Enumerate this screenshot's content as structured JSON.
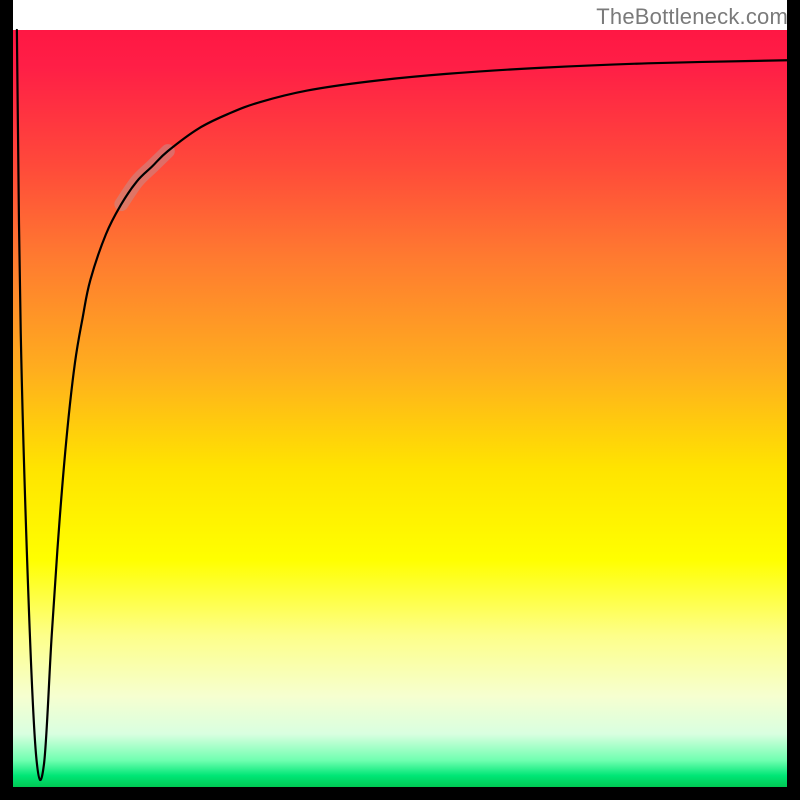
{
  "watermark": "TheBottleneck.com",
  "chart_data": {
    "type": "line",
    "title": "",
    "xlabel": "",
    "ylabel": "",
    "xlim": [
      0,
      100
    ],
    "ylim": [
      0,
      100
    ],
    "grid": false,
    "background_gradient": {
      "stops": [
        {
          "offset": 0.0,
          "color": "#ff1744"
        },
        {
          "offset": 0.05,
          "color": "#ff1f46"
        },
        {
          "offset": 0.18,
          "color": "#ff4a3a"
        },
        {
          "offset": 0.3,
          "color": "#ff7a30"
        },
        {
          "offset": 0.45,
          "color": "#ffae1e"
        },
        {
          "offset": 0.58,
          "color": "#ffe400"
        },
        {
          "offset": 0.7,
          "color": "#ffff00"
        },
        {
          "offset": 0.8,
          "color": "#fdff8a"
        },
        {
          "offset": 0.88,
          "color": "#f6ffd0"
        },
        {
          "offset": 0.93,
          "color": "#d9ffe0"
        },
        {
          "offset": 0.965,
          "color": "#6fffb0"
        },
        {
          "offset": 0.985,
          "color": "#00e676"
        },
        {
          "offset": 1.0,
          "color": "#00c853"
        }
      ]
    },
    "series": [
      {
        "name": "bottleneck-curve",
        "stroke": "#000000",
        "stroke_width": 2.2,
        "x": [
          0.5,
          1,
          2,
          3,
          4,
          5,
          6,
          7,
          8,
          9,
          10,
          12,
          14,
          16,
          18,
          20,
          24,
          28,
          32,
          38,
          46,
          56,
          68,
          82,
          100
        ],
        "y": [
          100,
          60,
          25,
          4,
          3,
          20,
          35,
          47,
          56,
          62,
          67,
          73,
          77,
          80,
          82,
          84,
          87,
          89,
          90.5,
          92,
          93.2,
          94.2,
          95,
          95.6,
          96
        ]
      }
    ],
    "highlight_segment": {
      "on_series": "bottleneck-curve",
      "x_range": [
        14,
        20
      ],
      "stroke": "#c58c8c",
      "opacity": 0.55,
      "width": 14
    },
    "frame": {
      "color": "#000000",
      "width": 13
    }
  }
}
